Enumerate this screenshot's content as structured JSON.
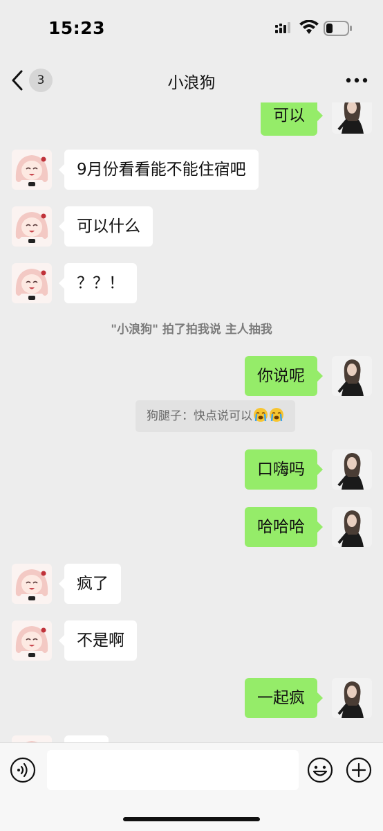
{
  "status_bar": {
    "time": "15:23"
  },
  "nav": {
    "unread_count": "3",
    "title": "小浪狗",
    "icons": {
      "back": "chevron-left-icon",
      "more": "more-dots-icon"
    }
  },
  "chat": {
    "messages": [
      {
        "from": "me",
        "text": "可以"
      },
      {
        "from": "other",
        "text": "9月份看看能不能住宿吧"
      },
      {
        "from": "other",
        "text": "可以什么"
      },
      {
        "from": "other",
        "text": "？？！"
      },
      {
        "system": "\"小浪狗\" 拍了拍我说  主人抽我"
      },
      {
        "from": "me",
        "text": "你说呢"
      },
      {
        "quote": "狗腿子：快点说可以"
      },
      {
        "from": "me",
        "text": "口嗨吗"
      },
      {
        "from": "me",
        "text": "哈哈哈"
      },
      {
        "from": "other",
        "text": "疯了"
      },
      {
        "from": "other",
        "text": "不是啊"
      },
      {
        "from": "me",
        "text": "一起疯"
      },
      {
        "from": "other",
        "text": ""
      }
    ]
  },
  "input_bar": {
    "placeholder": "",
    "icons": {
      "voice": "voice-icon",
      "emoji": "emoji-icon",
      "add": "plus-icon"
    }
  },
  "colors": {
    "background": "#ededed",
    "outgoing_bubble": "#95ec69",
    "incoming_bubble": "#ffffff",
    "system_text": "#7b7b7b"
  }
}
